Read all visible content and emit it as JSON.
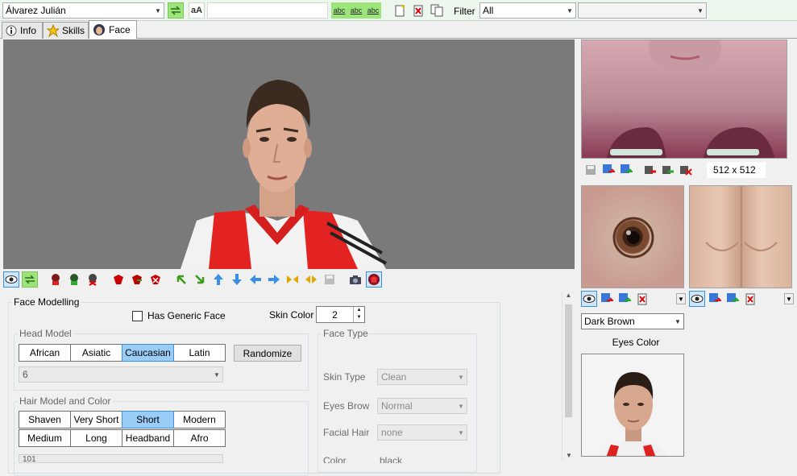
{
  "toolbar": {
    "player": "Álvarez Julián",
    "font_btn": "aA",
    "search_value": "",
    "abc": "abc",
    "filter_label": "Filter",
    "filter_value": "All",
    "extra_value": ""
  },
  "tabs": [
    {
      "label": "Info",
      "icon": "info-icon"
    },
    {
      "label": "Skills",
      "icon": "star-icon"
    },
    {
      "label": "Face",
      "icon": "face-icon"
    }
  ],
  "face": {
    "section_title": "Face Modelling",
    "generic_face_label": "Has Generic Face",
    "skin_color_label": "Skin Color",
    "skin_color_value": "2",
    "head_model": {
      "legend": "Head Model",
      "options": [
        "African",
        "Asiatic",
        "Caucasian",
        "Latin"
      ],
      "selected": "Caucasian",
      "randomize": "Randomize",
      "model_value": "6"
    },
    "hair_model": {
      "legend": "Hair Model and Color",
      "options_row1": [
        "Shaven",
        "Very Short",
        "Short",
        "Modern"
      ],
      "options_row2": [
        "Medium",
        "Long",
        "Headband",
        "Afro"
      ],
      "selected": "Short",
      "model_value": "101"
    },
    "face_type": {
      "legend": "Face Type",
      "skin_type_label": "Skin Type",
      "skin_type_value": "Clean",
      "eyes_brow_label": "Eyes Brow",
      "eyes_brow_value": "Normal",
      "facial_hair_label": "Facial Hair",
      "facial_hair_value": "none",
      "color_label": "Color",
      "color_value": "black"
    }
  },
  "right": {
    "texture_size": "512 x 512",
    "eye_color_value": "Dark Brown",
    "eye_color_label": "Eyes Color"
  }
}
